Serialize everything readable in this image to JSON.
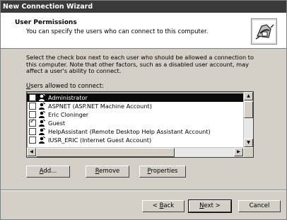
{
  "window": {
    "title": "New Connection Wizard"
  },
  "header": {
    "title": "User Permissions",
    "subtitle": "You can specify the users who can connect to this computer.",
    "icon": "dialup-connection-icon"
  },
  "description": "Select the check box next to each user who should be allowed a connection to this computer. Note that other factors, such as a disabled user account, may affect a user's ability to connect.",
  "users_label": {
    "accel": "U",
    "rest": "sers allowed to connect:"
  },
  "users": [
    {
      "name": "Administrator",
      "checked": false,
      "selected": true
    },
    {
      "name": "ASPNET (ASP.NET Machine Account)",
      "checked": false,
      "selected": false
    },
    {
      "name": "Eric Cloninger",
      "checked": false,
      "selected": false
    },
    {
      "name": "Guest",
      "checked": true,
      "selected": false
    },
    {
      "name": "HelpAssistant (Remote Desktop Help Assistant Account)",
      "checked": false,
      "selected": false
    },
    {
      "name": "IUSR_ERIC (Internet Guest Account)",
      "checked": false,
      "selected": false
    }
  ],
  "buttons": {
    "add": {
      "accel": "A",
      "rest": "dd..."
    },
    "remove": {
      "accel": "R",
      "rest": "emove"
    },
    "properties": {
      "accel": "P",
      "rest": "roperties"
    },
    "back": {
      "pre": "< ",
      "accel": "B",
      "rest": "ack"
    },
    "next": {
      "accel": "N",
      "rest": "ext >"
    },
    "cancel": "Cancel"
  }
}
